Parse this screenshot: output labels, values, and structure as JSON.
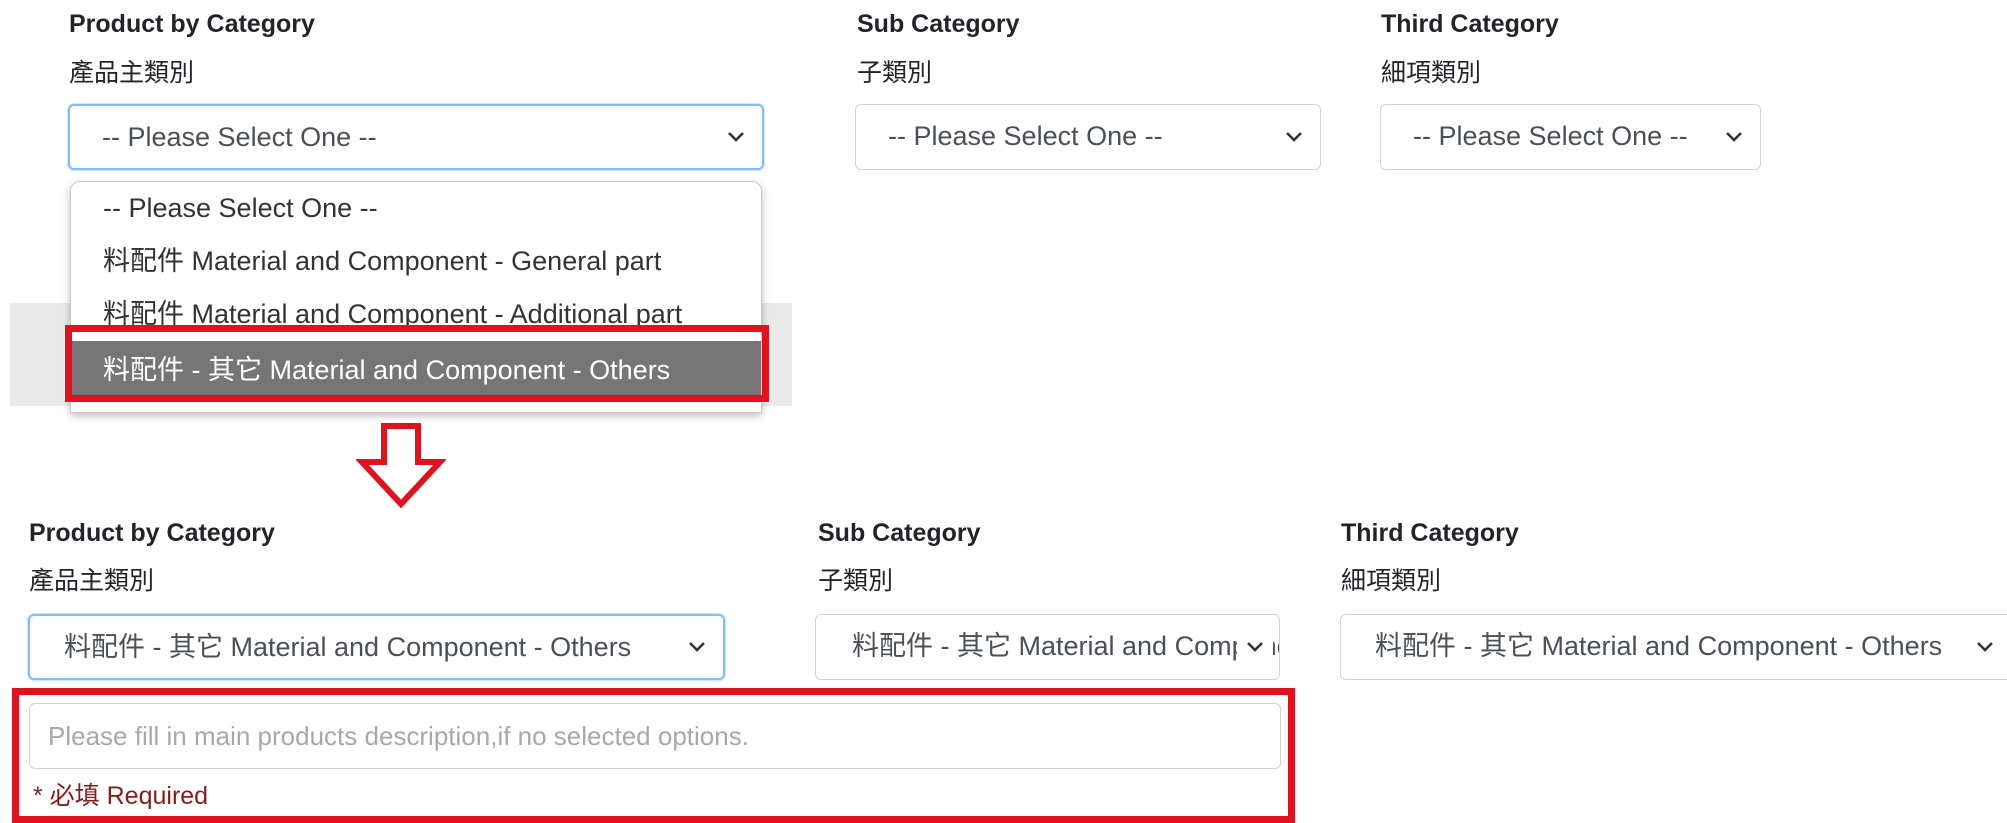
{
  "top": {
    "col1": {
      "label_en": "Product by Category",
      "label_zh": "產品主類別",
      "value": "-- Please Select One --"
    },
    "col2": {
      "label_en": "Sub Category",
      "label_zh": "子類別",
      "value": "-- Please Select One --"
    },
    "col3": {
      "label_en": "Third Category",
      "label_zh": "細項類別",
      "value": "-- Please Select One --"
    },
    "dropdown_options": [
      "-- Please Select One --",
      "料配件 Material and Component - General part",
      "料配件 Material and Component - Additional part",
      "料配件 - 其它 Material and Component - Others"
    ],
    "highlighted_option": "料配件 - 其它 Material and Component - Others"
  },
  "bottom": {
    "col1": {
      "label_en": "Product by Category",
      "label_zh": "產品主類別",
      "value": "料配件 - 其它 Material and Component - Others"
    },
    "col2": {
      "label_en": "Sub Category",
      "label_zh": "子類別",
      "value": "料配件 - 其它 Material and Component - Others"
    },
    "col3": {
      "label_en": "Third Category",
      "label_zh": "細項類別",
      "value": "料配件 - 其它 Material and Component - Others"
    },
    "description_placeholder": "Please fill in main products description,if no selected options.",
    "required_text": "* 必填 Required"
  },
  "icons": {
    "select_arrow": "chevron-down-icon",
    "transition_arrow": "arrow-down-outline-icon"
  },
  "colors": {
    "highlight_border": "#e3101e",
    "focus_border": "#80bdff",
    "selected_option_bg": "#767676",
    "required_text": "#8b1a1a"
  }
}
